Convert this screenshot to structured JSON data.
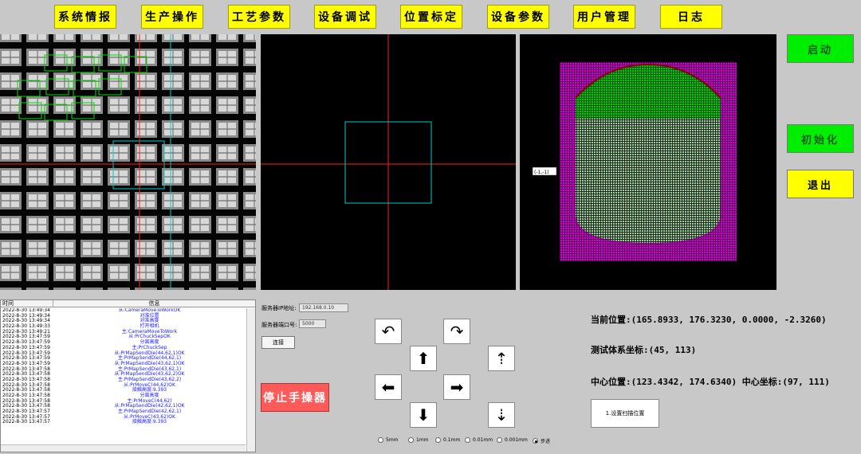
{
  "tabs": [
    "系统情报",
    "生产操作",
    "工艺参数",
    "设备调试",
    "位置标定",
    "设备参数",
    "用户管理",
    "日志"
  ],
  "side_buttons": {
    "start": "启动",
    "init": "初始化",
    "exit": "退出"
  },
  "wafer_label": "(-1,-1)",
  "log": {
    "col_time": "时间",
    "col_info": "信息",
    "rows": [
      {
        "t": "2022-8-30  13:49:34",
        "m": "从:CameraMoveToWorkOK"
      },
      {
        "t": "2022-8-30  13:49:34",
        "m": "对准位置"
      },
      {
        "t": "2022-8-30  13:49:34",
        "m": "对准高度"
      },
      {
        "t": "2022-8-30  13:49:33",
        "m": "打开相机"
      },
      {
        "t": "2022-8-30  13:49:21",
        "m": "主:CameraMoveToWork"
      },
      {
        "t": "2022-8-30  13:47:59",
        "m": "从:PrChuckSepOK"
      },
      {
        "t": "2022-8-30  13:47:59",
        "m": "分离高度"
      },
      {
        "t": "2022-8-30  13:47:59",
        "m": "主:PrChuckSep"
      },
      {
        "t": "2022-8-30  13:47:59",
        "m": "从:PrMapSendDie(44,62,1)OK"
      },
      {
        "t": "2022-8-30  13:47:59",
        "m": "主:PrMapSendDie(44,62,1)"
      },
      {
        "t": "2022-8-30  13:47:59",
        "m": "从:PrMapSendDie(43,62,1)OK"
      },
      {
        "t": "2022-8-30  13:47:58",
        "m": "主:PrMapSendDie(43,62,1)"
      },
      {
        "t": "2022-8-30  13:47:58",
        "m": "从:PrMapSendDie(43,62,2)OK"
      },
      {
        "t": "2022-8-30  13:47:58",
        "m": "主:PrMapSendDie(43,62,2)"
      },
      {
        "t": "2022-8-30  13:47:58",
        "m": "从:PrMoveC(44,62)OK"
      },
      {
        "t": "2022-8-30  13:47:58",
        "m": "接触高度:9.393"
      },
      {
        "t": "2022-8-30  13:47:58",
        "m": "分离高度"
      },
      {
        "t": "2022-8-30  13:47:58",
        "m": "主:PrMoveC(44,62)"
      },
      {
        "t": "2022-8-30  13:47:58",
        "m": "从:PrMapSendDie(42,62,1)OK"
      },
      {
        "t": "2022-8-30  13:47:57",
        "m": "主:PrMapSendDie(42,62,1)"
      },
      {
        "t": "2022-8-30  13:47:57",
        "m": "从:PrMoveC(43,62)OK"
      },
      {
        "t": "2022-8-30  13:47:57",
        "m": "接触高度:9.393"
      }
    ]
  },
  "server": {
    "ip_label": "服务器IP地址:",
    "ip_value": "192.168.0.10",
    "port_label": "服务器端口号:",
    "port_value": "5000",
    "connect": "连接"
  },
  "stop_button": "停止手操器",
  "arrows": {
    "rot_ccw": "↶",
    "rot_cw": "↷",
    "up": "⬆",
    "left": "⬅",
    "right": "➡",
    "down": "⬇",
    "z_up": "⇡",
    "z_down": "⇣"
  },
  "steps": [
    {
      "label": "5mm",
      "on": false
    },
    {
      "label": "1mm",
      "on": false
    },
    {
      "label": "0.1mm",
      "on": false
    },
    {
      "label": "0.01mm",
      "on": false
    },
    {
      "label": "0.001mm",
      "on": false
    },
    {
      "label": "步进",
      "on": true
    }
  ],
  "status": {
    "current_pos": "当前位置:(165.8933, 176.3230, 0.0000, -2.3260)",
    "test_coord": "测试体系坐标:(45, 113)",
    "center": "中心位置:(123.4342, 174.6340) 中心坐标:(97, 111)"
  },
  "scan_button": "1.设置扫描位置",
  "colors": {
    "tab": "#ffff00",
    "start": "#00ee00",
    "stop": "#ff5a5a",
    "wafer_bg": "#b000b0",
    "wafer_top": "#00aa00"
  }
}
